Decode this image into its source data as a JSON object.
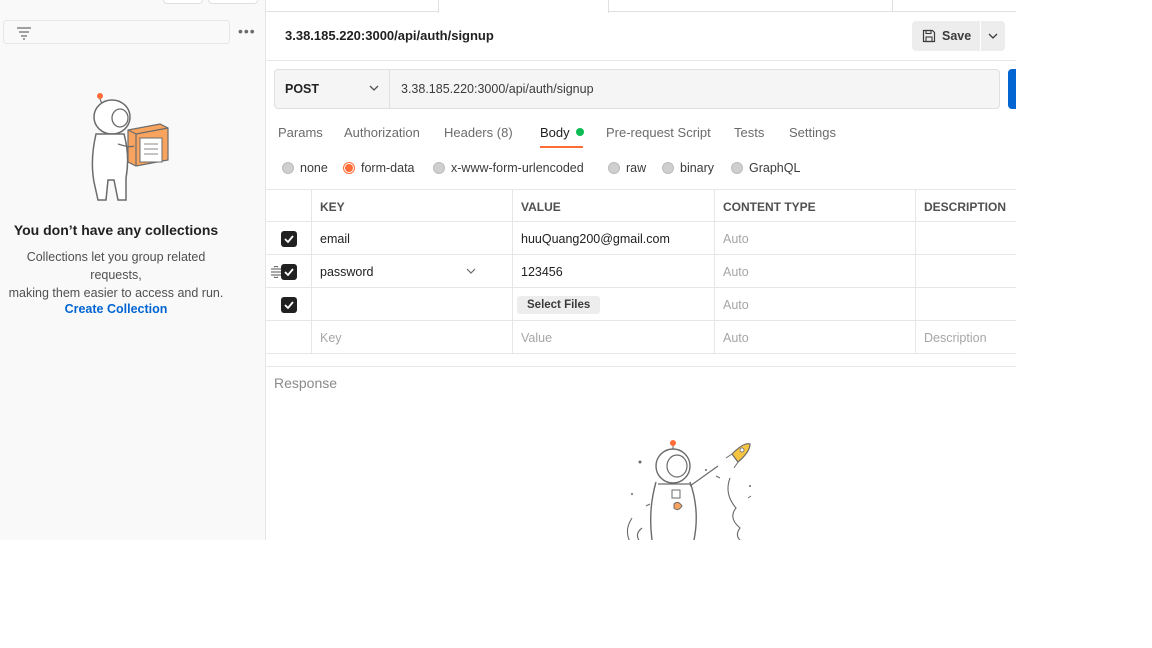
{
  "sidebar": {
    "empty_title": "You don’t have any collections",
    "empty_desc_line1": "Collections let you group related requests,",
    "empty_desc_line2": "making them easier to access and run.",
    "create_label": "Create Collection",
    "more_label": "•••"
  },
  "request": {
    "title": "3.38.185.220:3000/api/auth/signup",
    "save_label": "Save",
    "method": "POST",
    "url": "3.38.185.220:3000/api/auth/signup"
  },
  "tabs": [
    {
      "label": "Params"
    },
    {
      "label": "Authorization"
    },
    {
      "label": "Headers",
      "count": "(8)"
    },
    {
      "label": "Body"
    },
    {
      "label": "Pre-request Script"
    },
    {
      "label": "Tests"
    },
    {
      "label": "Settings"
    }
  ],
  "body_modes": [
    {
      "label": "none",
      "selected": false
    },
    {
      "label": "form-data",
      "selected": true
    },
    {
      "label": "x-www-form-urlencoded",
      "selected": false
    },
    {
      "label": "raw",
      "selected": false
    },
    {
      "label": "binary",
      "selected": false
    },
    {
      "label": "GraphQL",
      "selected": false
    }
  ],
  "table": {
    "headers": {
      "key": "KEY",
      "value": "VALUE",
      "content_type": "CONTENT TYPE",
      "description": "DESCRIPTION"
    },
    "rows": [
      {
        "key": "email",
        "value": "huuQuang200@gmail.com",
        "content_type": "Auto"
      },
      {
        "key": "password",
        "value": "123456",
        "content_type": "Auto"
      },
      {
        "key": "",
        "value_button": "Select Files",
        "content_type": "Auto"
      }
    ],
    "placeholder": {
      "key": "Key",
      "value": "Value",
      "content_type": "Auto",
      "description": "Description"
    }
  },
  "response": {
    "label": "Response"
  },
  "colors": {
    "accent": "#ff6c37",
    "brand_blue": "#0265d2",
    "body_dot": "#0cbb52"
  }
}
